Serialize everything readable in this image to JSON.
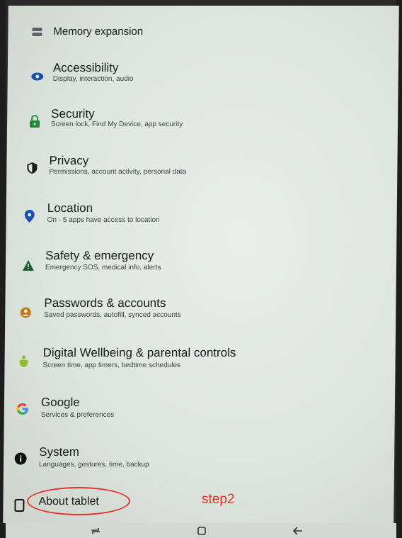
{
  "settings": {
    "items": [
      {
        "title": "Memory expansion",
        "subtitle": "",
        "icon": "memory-icon",
        "color": "#5f6368"
      },
      {
        "title": "Accessibility",
        "subtitle": "Display, interaction, audio",
        "icon": "eye-icon",
        "color": "#1a4fb5"
      },
      {
        "title": "Security",
        "subtitle": "Screen lock, Find My Device, app security",
        "icon": "lock-icon",
        "color": "#1f8a3a"
      },
      {
        "title": "Privacy",
        "subtitle": "Permissions, account activity, personal data",
        "icon": "shield-icon",
        "color": "#1b1b1b"
      },
      {
        "title": "Location",
        "subtitle": "On - 5 apps have access to location",
        "icon": "location-pin-icon",
        "color": "#1a4fb5"
      },
      {
        "title": "Safety & emergency",
        "subtitle": "Emergency SOS, medical info, alerts",
        "icon": "warning-icon",
        "color": "#1e5b2e"
      },
      {
        "title": "Passwords & accounts",
        "subtitle": "Saved passwords, autofill, synced accounts",
        "icon": "key-person-icon",
        "color": "#c27a16"
      },
      {
        "title": "Digital Wellbeing & parental controls",
        "subtitle": "Screen time, app timers, bedtime schedules",
        "icon": "wellbeing-icon",
        "color": "#8bbf2e"
      },
      {
        "title": "Google",
        "subtitle": "Services & preferences",
        "icon": "google-icon",
        "color": "#4285f4"
      },
      {
        "title": "System",
        "subtitle": "Languages, gestures, time, backup",
        "icon": "info-icon",
        "color": "#111111"
      },
      {
        "title": "About tablet",
        "subtitle": "",
        "icon": "tablet-icon",
        "color": "#111111"
      }
    ]
  },
  "annotation": {
    "label": "step2",
    "color": "#e4332e"
  },
  "navbar": {
    "buttons": [
      "recents-icon",
      "home-icon",
      "back-icon"
    ]
  }
}
